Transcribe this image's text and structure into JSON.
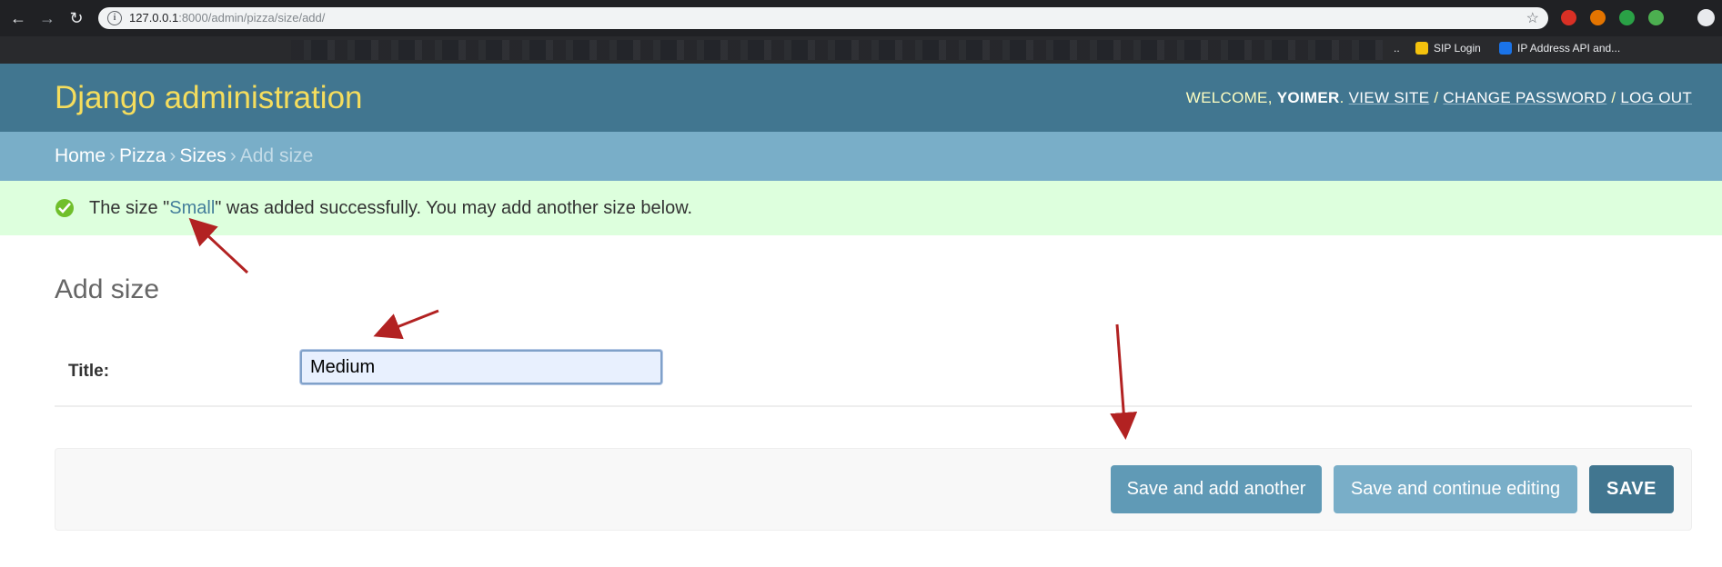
{
  "browser": {
    "url_host": "127.0.0.1",
    "url_rest": ":8000/admin/pizza/size/add/",
    "bookmarks": [
      {
        "label": "..",
        "icon": "overflow-icon"
      },
      {
        "label": "SIP Login",
        "icon": "sip-icon"
      },
      {
        "label": "IP Address API and...",
        "icon": "ip-api-icon"
      }
    ]
  },
  "header": {
    "brand": "Django administration",
    "welcome": "WELCOME,",
    "username": "YOIMER",
    "view_site": "VIEW SITE",
    "change_password": "CHANGE PASSWORD",
    "log_out": "LOG OUT",
    "sep": "/"
  },
  "breadcrumbs": {
    "home": "Home",
    "app": "Pizza",
    "model": "Sizes",
    "current": "Add size",
    "sep": "›"
  },
  "message": {
    "before": "The size \"",
    "link": "Small",
    "after": "\" was added successfully. You may add another size below."
  },
  "page": {
    "title": "Add size"
  },
  "form": {
    "title_label": "Title:",
    "title_value": "Medium"
  },
  "buttons": {
    "save_add_another": "Save and add another",
    "save_continue": "Save and continue editing",
    "save": "SAVE"
  },
  "colors": {
    "header_bg": "#417690",
    "brand": "#f5dd5d",
    "breadcrumb_bg": "#79aec8",
    "success_bg": "#ddffdd",
    "annotation_arrow": "#b22222"
  }
}
